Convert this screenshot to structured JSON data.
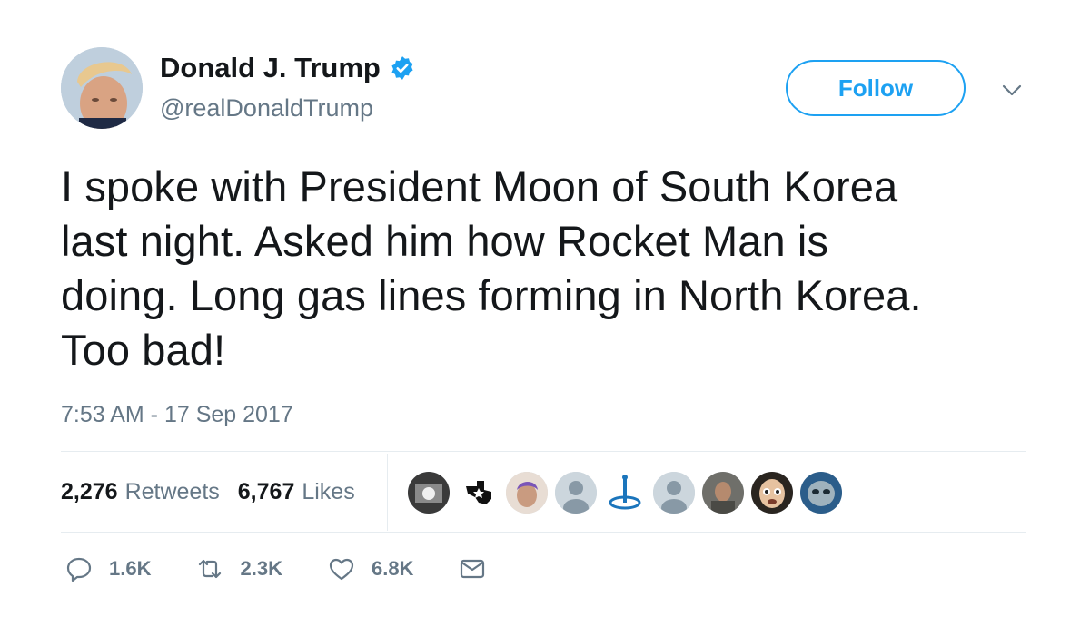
{
  "author": {
    "name": "Donald J. Trump",
    "handle": "@realDonaldTrump",
    "verified": true
  },
  "follow_button": {
    "label": "Follow"
  },
  "tweet": {
    "text": "I spoke with President Moon of South Korea\nlast night. Asked him how Rocket Man is\ndoing. Long gas lines forming in North Korea.\nToo bad!",
    "timestamp": "7:53 AM - 17 Sep 2017"
  },
  "stats": {
    "retweets": {
      "count": "2,276",
      "label": "Retweets"
    },
    "likes": {
      "count": "6,767",
      "label": "Likes"
    }
  },
  "actions": {
    "reply": {
      "icon": "reply-icon",
      "count": "1.6K"
    },
    "retweet": {
      "icon": "retweet-icon",
      "count": "2.3K"
    },
    "like": {
      "icon": "heart-icon",
      "count": "6.8K"
    },
    "message": {
      "icon": "mail-icon"
    }
  },
  "colors": {
    "accent": "#1da1f2",
    "text": "#14171a",
    "secondary": "#657786",
    "divider": "#e6ecf0"
  }
}
